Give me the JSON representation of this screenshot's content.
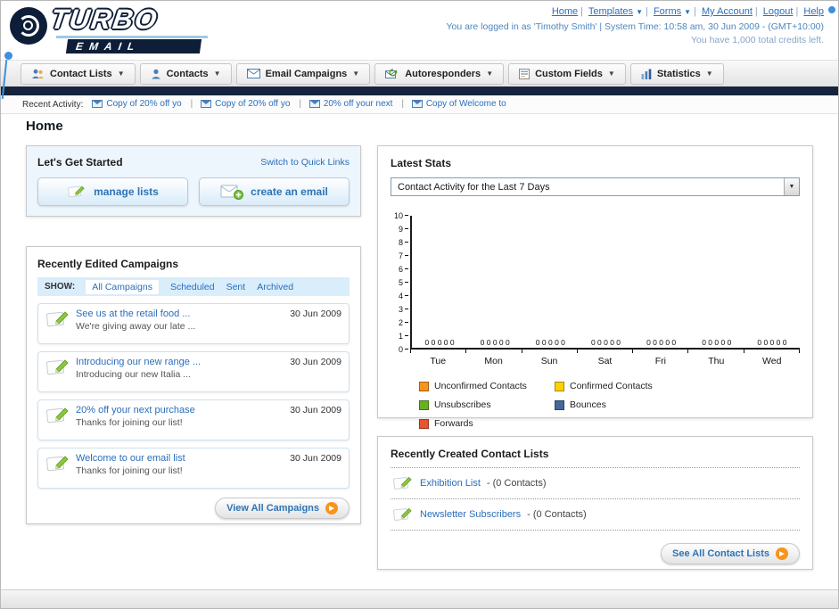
{
  "header": {
    "logo_line1": "TURBO",
    "logo_line2": "EMAIL",
    "links": [
      "Home",
      "Templates",
      "Forms",
      "My Account",
      "Logout",
      "Help"
    ],
    "login_info": "You are logged in as 'Timothy Smith' | System Time: 10:58 am, 30 Jun 2009 - (GMT+10:00)",
    "credits_info": "You have 1,000 total credits left."
  },
  "nav_tabs": [
    {
      "label": "Contact Lists",
      "icon": "contact-lists-icon"
    },
    {
      "label": "Contacts",
      "icon": "contacts-icon"
    },
    {
      "label": "Email Campaigns",
      "icon": "email-campaigns-icon"
    },
    {
      "label": "Autoresponders",
      "icon": "autoresponders-icon"
    },
    {
      "label": "Custom Fields",
      "icon": "custom-fields-icon"
    },
    {
      "label": "Statistics",
      "icon": "statistics-icon"
    }
  ],
  "recent_activity": {
    "label": "Recent Activity:",
    "items": [
      "Copy of 20% off yo",
      "Copy of 20% off yo",
      "20% off your next",
      "Copy of Welcome to"
    ]
  },
  "page_title": "Home",
  "get_started": {
    "title": "Let's Get Started",
    "switch_link": "Switch to Quick Links",
    "buttons": [
      "manage lists",
      "create an email"
    ]
  },
  "campaigns": {
    "title": "Recently Edited Campaigns",
    "show_label": "SHOW:",
    "tabs": [
      "All Campaigns",
      "Scheduled",
      "Sent",
      "Archived"
    ],
    "selected_tab": "All Campaigns",
    "items": [
      {
        "title": "See us at the retail food ...",
        "subtitle": "We're giving away our late ...",
        "date": "30 Jun 2009"
      },
      {
        "title": "Introducing our new range ...",
        "subtitle": "Introducing our new Italia ...",
        "date": "30 Jun 2009"
      },
      {
        "title": "20% off your next purchase",
        "subtitle": "Thanks for joining our list!",
        "date": "30 Jun 2009"
      },
      {
        "title": "Welcome to our email list",
        "subtitle": "Thanks for joining our list!",
        "date": "30 Jun 2009"
      }
    ],
    "view_all_button": "View All Campaigns"
  },
  "latest_stats": {
    "title": "Latest Stats",
    "dropdown_value": "Contact Activity for the Last 7 Days",
    "chart_data": {
      "type": "bar",
      "title": "Contact Activity for the Last 7 Days",
      "categories": [
        "Tue",
        "Mon",
        "Sun",
        "Sat",
        "Fri",
        "Thu",
        "Wed"
      ],
      "series": [
        {
          "name": "Unconfirmed Contacts",
          "color": "#f7941d",
          "values": [
            0,
            0,
            0,
            0,
            0,
            0,
            0
          ]
        },
        {
          "name": "Confirmed Contacts",
          "color": "#ffd100",
          "values": [
            0,
            0,
            0,
            0,
            0,
            0,
            0
          ]
        },
        {
          "name": "Unsubscribes",
          "color": "#6ab023",
          "values": [
            0,
            0,
            0,
            0,
            0,
            0,
            0
          ]
        },
        {
          "name": "Bounces",
          "color": "#46679b",
          "values": [
            0,
            0,
            0,
            0,
            0,
            0,
            0
          ]
        },
        {
          "name": "Forwards",
          "color": "#e8542c",
          "values": [
            0,
            0,
            0,
            0,
            0,
            0,
            0
          ]
        }
      ],
      "ylim": [
        0,
        10
      ],
      "grid": false,
      "legend_position": "bottom"
    }
  },
  "contact_lists": {
    "title": "Recently Created Contact Lists",
    "items": [
      {
        "name": "Exhibition List",
        "suffix": "- (0 Contacts)"
      },
      {
        "name": "Newsletter Subscribers",
        "suffix": "- (0 Contacts)"
      }
    ],
    "see_all_button": "See All Contact Lists"
  }
}
